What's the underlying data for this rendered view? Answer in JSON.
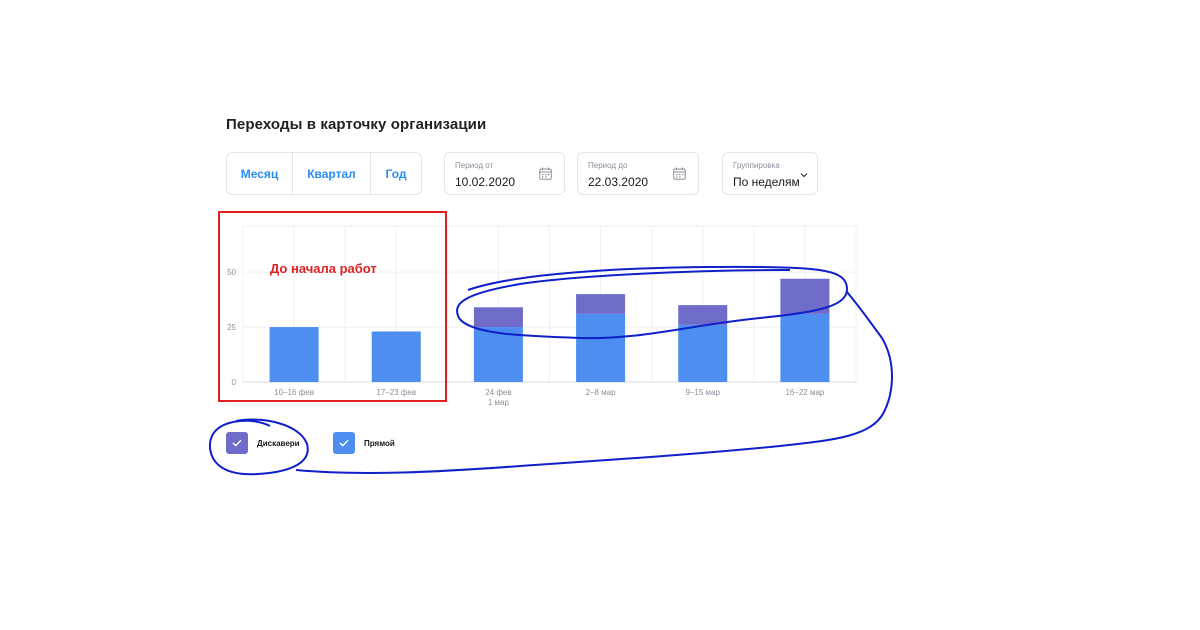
{
  "page": {
    "title": "Переходы в карточку организации"
  },
  "period_tabs": [
    {
      "label": "Месяц"
    },
    {
      "label": "Квартал"
    },
    {
      "label": "Год"
    }
  ],
  "period_from": {
    "label": "Период от",
    "value": "10.02.2020"
  },
  "period_to": {
    "label": "Период до",
    "value": "22.03.2020"
  },
  "grouping": {
    "label": "Группировка",
    "value": "По неделям"
  },
  "annotation": {
    "text": "До начала работ",
    "colors": {
      "rect": "#e02020",
      "scribble": "#1020c8"
    }
  },
  "legend": [
    {
      "label": "Дискавери",
      "color": "#6f6cc9",
      "checked": true
    },
    {
      "label": "Прямой",
      "color": "#4d8ef0",
      "checked": true
    }
  ],
  "chart_data": {
    "type": "bar",
    "stacked": true,
    "categories": [
      "10–16 фев",
      "17–23 фев",
      "24 фев\n1 мар",
      "2–8 мар",
      "9–15 мар",
      "16–22 мар"
    ],
    "series": [
      {
        "name": "Прямой",
        "color": "#4d8ef0",
        "values": [
          25,
          23,
          25,
          31,
          26,
          31
        ]
      },
      {
        "name": "Дискавери",
        "color": "#6f6cc9",
        "values": [
          0,
          0,
          9,
          9,
          9,
          16
        ]
      }
    ],
    "y_ticks": [
      0,
      25,
      50
    ],
    "ylim": [
      0,
      71
    ],
    "grid": true
  }
}
